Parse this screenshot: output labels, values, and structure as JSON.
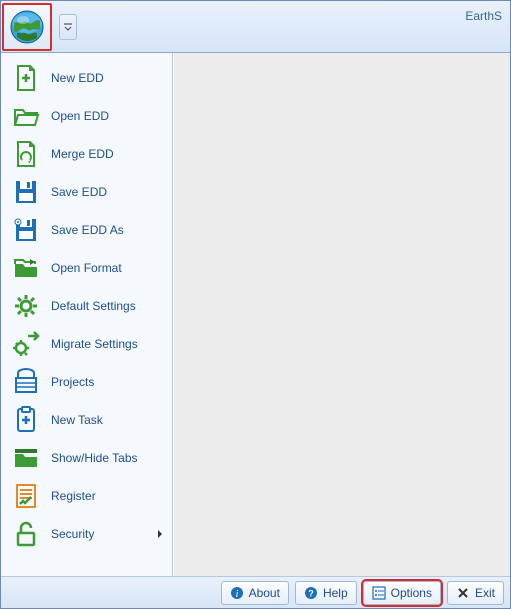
{
  "title": "EarthS",
  "menu": {
    "items": [
      {
        "label": "New EDD"
      },
      {
        "label": "Open EDD"
      },
      {
        "label": "Merge EDD"
      },
      {
        "label": "Save EDD"
      },
      {
        "label": "Save EDD As"
      },
      {
        "label": "Open Format"
      },
      {
        "label": "Default Settings"
      },
      {
        "label": "Migrate Settings"
      },
      {
        "label": "Projects"
      },
      {
        "label": "New Task"
      },
      {
        "label": "Show/Hide Tabs"
      },
      {
        "label": "Register"
      },
      {
        "label": "Security"
      }
    ]
  },
  "footer": {
    "about": "About",
    "help": "Help",
    "options": "Options",
    "exit": "Exit"
  },
  "colors": {
    "green": "#3e9a34",
    "blue": "#1d6fb7",
    "highlight": "#d92c2c",
    "text": "#1d4e8f"
  }
}
